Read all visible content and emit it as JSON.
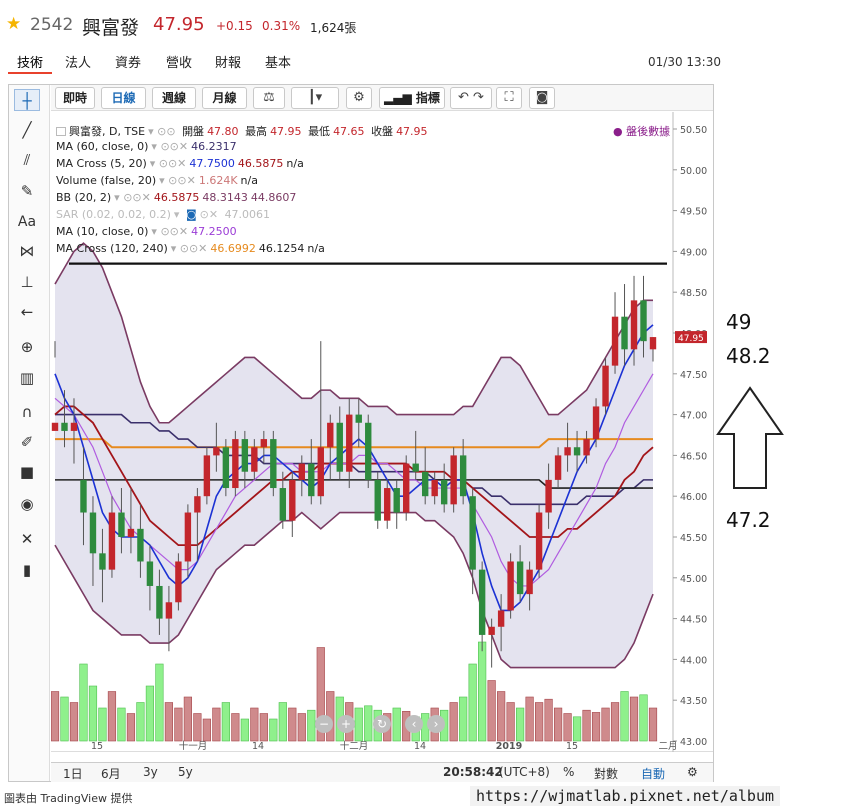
{
  "header": {
    "code": "2542",
    "name": "興富發",
    "price": "47.95",
    "change": "+0.15",
    "pct": "0.31%",
    "volume": "1,624張"
  },
  "tabs": [
    "技術",
    "法人",
    "營收",
    "營收",
    "財報",
    "基本"
  ],
  "datetime": "01/30 13:30",
  "toolbar": {
    "realtime": "即時",
    "daily": "日線",
    "weekly": "週線",
    "monthly": "月線",
    "indicators": "指標"
  },
  "legend": {
    "title": "興富發, D, TSE",
    "open_l": "開盤",
    "open": "47.80",
    "high_l": "最高",
    "high": "47.95",
    "low_l": "最低",
    "low": "47.65",
    "close_l": "收盤",
    "close": "47.95",
    "after_hours": "盤後數據",
    "ma60": {
      "label": "MA (60, close, 0)",
      "v1": "46.2317"
    },
    "macross1": {
      "label": "MA Cross (5, 20)",
      "v1": "47.7500",
      "v2": "46.5875",
      "v3": "n/a"
    },
    "volume": {
      "label": "Volume (false, 20)",
      "v1": "1.624K",
      "v2": "n/a"
    },
    "bb": {
      "label": "BB (20, 2)",
      "v1": "46.5875",
      "v2": "48.3143",
      "v3": "44.8607"
    },
    "sar": {
      "label": "SAR (0.02, 0.02, 0.2)",
      "v1": "47.0061"
    },
    "ma10": {
      "label": "MA (10, close, 0)",
      "v1": "47.2500"
    },
    "macross2": {
      "label": "MA Cross (120, 240)",
      "v1": "46.6992",
      "v2": "46.1254",
      "v3": "n/a"
    }
  },
  "axis": {
    "y_ticks": [
      "50.50",
      "50.00",
      "49.50",
      "49.00",
      "48.50",
      "48.00",
      "47.50",
      "47.00",
      "46.50",
      "46.00",
      "45.50",
      "45.00",
      "44.50",
      "44.00",
      "43.50",
      "43.00"
    ],
    "price_tag": "47.95",
    "x_ticks": [
      "15",
      "十一月",
      "14",
      "十二月",
      "14",
      "2019",
      "15",
      "二月"
    ]
  },
  "bottombar": {
    "r1d": "1日",
    "r6m": "6月",
    "r3y": "3y",
    "r5y": "5y",
    "clock": "20:58:42",
    "tz": "(UTC+8)",
    "pct": "%",
    "log": "對數",
    "auto": "自動"
  },
  "annotations": {
    "a49": "49",
    "a482": "48.2",
    "a472": "47.2"
  },
  "footer": {
    "credit": "圖表由 TradingView 提供",
    "watermark": "https://wjmatlab.pixnet.net/album"
  },
  "colors": {
    "up": "#c3262c",
    "down": "#2e8b3e",
    "ma5": "#1c32d4",
    "ma20": "#a3151a",
    "ma10": "#b05ce0",
    "ma60": "#3a2f6b",
    "ma120": "#e68a1e",
    "bb": "#7a3b63"
  },
  "chart_data": {
    "type": "candlestick",
    "dates": [
      "2018-10-01",
      "2019-01-30"
    ],
    "ylim": [
      43.0,
      50.5
    ],
    "reference_line": 48.85,
    "candles": [
      [
        46.8,
        47.9,
        47.7,
        46.9
      ],
      [
        46.9,
        47.3,
        46.6,
        46.8
      ],
      [
        46.8,
        47.2,
        46.4,
        46.9
      ],
      [
        46.2,
        46.6,
        45.4,
        45.8
      ],
      [
        45.8,
        46.0,
        44.9,
        45.3
      ],
      [
        45.3,
        45.6,
        44.7,
        45.1
      ],
      [
        45.1,
        46.0,
        45.0,
        45.8
      ],
      [
        45.8,
        46.1,
        45.3,
        45.5
      ],
      [
        45.5,
        46.1,
        45.3,
        45.6
      ],
      [
        45.6,
        45.9,
        45.0,
        45.2
      ],
      [
        45.2,
        45.4,
        44.6,
        44.9
      ],
      [
        44.9,
        45.1,
        44.3,
        44.5
      ],
      [
        44.5,
        44.9,
        44.1,
        44.7
      ],
      [
        44.7,
        45.3,
        44.6,
        45.2
      ],
      [
        45.2,
        45.9,
        45.0,
        45.8
      ],
      [
        45.8,
        46.1,
        45.2,
        46.0
      ],
      [
        46.0,
        46.6,
        45.9,
        46.5
      ],
      [
        46.5,
        46.9,
        46.3,
        46.6
      ],
      [
        46.6,
        46.7,
        46.0,
        46.1
      ],
      [
        46.1,
        46.8,
        46.0,
        46.7
      ],
      [
        46.7,
        46.8,
        46.1,
        46.3
      ],
      [
        46.3,
        46.7,
        46.2,
        46.6
      ],
      [
        46.6,
        46.8,
        46.4,
        46.7
      ],
      [
        46.7,
        46.8,
        46.0,
        46.1
      ],
      [
        46.1,
        46.3,
        45.6,
        45.7
      ],
      [
        45.7,
        46.3,
        45.5,
        46.2
      ],
      [
        46.2,
        46.5,
        46.0,
        46.4
      ],
      [
        46.4,
        46.7,
        45.9,
        46.0
      ],
      [
        46.0,
        47.9,
        45.9,
        46.6
      ],
      [
        46.6,
        47.0,
        46.2,
        46.9
      ],
      [
        46.9,
        47.1,
        46.2,
        46.3
      ],
      [
        46.3,
        47.2,
        46.1,
        47.0
      ],
      [
        47.0,
        47.2,
        46.6,
        46.9
      ],
      [
        46.9,
        47.0,
        46.1,
        46.2
      ],
      [
        46.2,
        46.3,
        45.6,
        45.7
      ],
      [
        45.7,
        46.2,
        45.6,
        46.1
      ],
      [
        46.1,
        46.2,
        45.6,
        45.8
      ],
      [
        45.8,
        46.5,
        45.7,
        46.4
      ],
      [
        46.4,
        46.8,
        46.2,
        46.3
      ],
      [
        46.3,
        46.6,
        45.9,
        46.0
      ],
      [
        46.0,
        46.3,
        45.9,
        46.2
      ],
      [
        46.2,
        46.4,
        45.8,
        45.9
      ],
      [
        45.9,
        46.6,
        45.8,
        46.5
      ],
      [
        46.5,
        46.7,
        45.9,
        46.0
      ],
      [
        46.0,
        46.1,
        44.8,
        45.1
      ],
      [
        45.1,
        45.2,
        44.1,
        44.3
      ],
      [
        44.3,
        44.5,
        43.9,
        44.4
      ],
      [
        44.4,
        44.8,
        44.1,
        44.6
      ],
      [
        44.6,
        45.3,
        44.5,
        45.2
      ],
      [
        45.2,
        45.4,
        44.7,
        44.8
      ],
      [
        44.8,
        45.2,
        44.6,
        45.1
      ],
      [
        45.1,
        45.9,
        45.0,
        45.8
      ],
      [
        45.8,
        46.4,
        45.6,
        46.2
      ],
      [
        46.2,
        46.6,
        46.1,
        46.5
      ],
      [
        46.5,
        46.9,
        46.3,
        46.6
      ],
      [
        46.6,
        46.8,
        46.3,
        46.5
      ],
      [
        46.5,
        46.8,
        46.4,
        46.7
      ],
      [
        46.7,
        47.2,
        46.6,
        47.1
      ],
      [
        47.1,
        47.7,
        47.0,
        47.6
      ],
      [
        47.6,
        48.5,
        47.5,
        48.2
      ],
      [
        48.2,
        48.6,
        47.6,
        47.8
      ],
      [
        47.8,
        48.7,
        47.6,
        48.4
      ],
      [
        48.4,
        48.7,
        47.7,
        47.9
      ],
      [
        47.8,
        47.95,
        47.65,
        47.95
      ]
    ],
    "volume": [
      0.45,
      0.4,
      0.35,
      0.7,
      0.5,
      0.3,
      0.45,
      0.3,
      0.25,
      0.35,
      0.5,
      0.7,
      0.35,
      0.3,
      0.4,
      0.25,
      0.2,
      0.3,
      0.35,
      0.25,
      0.2,
      0.3,
      0.25,
      0.2,
      0.35,
      0.3,
      0.25,
      0.28,
      0.85,
      0.45,
      0.4,
      0.35,
      0.3,
      0.32,
      0.28,
      0.25,
      0.3,
      0.27,
      0.22,
      0.25,
      0.3,
      0.28,
      0.35,
      0.4,
      0.7,
      0.9,
      0.55,
      0.45,
      0.35,
      0.3,
      0.4,
      0.35,
      0.38,
      0.3,
      0.25,
      0.22,
      0.28,
      0.26,
      0.3,
      0.35,
      0.45,
      0.4,
      0.42,
      0.3
    ],
    "ma5": [
      47.5,
      47.2,
      47.0,
      46.6,
      46.2,
      45.8,
      45.6,
      45.5,
      45.5,
      45.5,
      45.4,
      45.2,
      45.0,
      44.9,
      45.0,
      45.2,
      45.6,
      46.0,
      46.2,
      46.3,
      46.4,
      46.4,
      46.5,
      46.5,
      46.4,
      46.3,
      46.2,
      46.1,
      46.2,
      46.4,
      46.5,
      46.6,
      46.7,
      46.6,
      46.4,
      46.2,
      46.0,
      46.0,
      46.1,
      46.2,
      46.2,
      46.1,
      46.2,
      46.2,
      45.8,
      45.3,
      44.9,
      44.6,
      44.6,
      44.7,
      44.9,
      45.1,
      45.4,
      45.7,
      46.0,
      46.3,
      46.5,
      46.7,
      47.0,
      47.3,
      47.6,
      47.8,
      48.0,
      48.1
    ],
    "ma10": [
      47.2,
      47.1,
      47.0,
      46.8,
      46.6,
      46.3,
      46.0,
      45.8,
      45.6,
      45.5,
      45.4,
      45.3,
      45.2,
      45.1,
      45.1,
      45.2,
      45.4,
      45.6,
      45.8,
      46.0,
      46.1,
      46.2,
      46.3,
      46.4,
      46.4,
      46.4,
      46.3,
      46.3,
      46.3,
      46.4,
      46.4,
      46.4,
      46.5,
      46.5,
      46.4,
      46.4,
      46.3,
      46.2,
      46.2,
      46.1,
      46.1,
      46.1,
      46.1,
      46.1,
      45.9,
      45.7,
      45.5,
      45.2,
      45.0,
      44.9,
      44.9,
      45.0,
      45.1,
      45.3,
      45.5,
      45.7,
      45.9,
      46.1,
      46.4,
      46.6,
      46.9,
      47.1,
      47.3,
      47.5
    ],
    "ma20": [
      47.0,
      47.1,
      47.1,
      47.0,
      46.9,
      46.7,
      46.5,
      46.3,
      46.1,
      45.9,
      45.7,
      45.6,
      45.5,
      45.4,
      45.4,
      45.4,
      45.5,
      45.6,
      45.7,
      45.8,
      45.9,
      46.0,
      46.1,
      46.2,
      46.2,
      46.3,
      46.3,
      46.3,
      46.4,
      46.4,
      46.4,
      46.4,
      46.4,
      46.4,
      46.4,
      46.4,
      46.4,
      46.4,
      46.3,
      46.3,
      46.3,
      46.3,
      46.2,
      46.2,
      46.1,
      46.0,
      45.9,
      45.8,
      45.7,
      45.6,
      45.5,
      45.5,
      45.5,
      45.5,
      45.6,
      45.6,
      45.7,
      45.8,
      45.9,
      46.0,
      46.2,
      46.3,
      46.5,
      46.6
    ],
    "ma60": [
      47.0,
      47.0,
      47.0,
      47.0,
      47.0,
      47.0,
      47.0,
      47.0,
      46.9,
      46.9,
      46.9,
      46.8,
      46.8,
      46.7,
      46.7,
      46.6,
      46.6,
      46.6,
      46.5,
      46.5,
      46.5,
      46.5,
      46.4,
      46.4,
      46.4,
      46.4,
      46.4,
      46.4,
      46.4,
      46.4,
      46.4,
      46.4,
      46.3,
      46.3,
      46.3,
      46.3,
      46.3,
      46.3,
      46.3,
      46.3,
      46.2,
      46.2,
      46.2,
      46.2,
      46.1,
      46.1,
      46.0,
      46.0,
      45.9,
      45.9,
      45.9,
      45.9,
      45.9,
      45.9,
      45.9,
      45.9,
      46.0,
      46.0,
      46.0,
      46.0,
      46.1,
      46.1,
      46.2,
      46.2
    ],
    "ma120": [
      46.7,
      46.7,
      46.7,
      46.7,
      46.7,
      46.7,
      46.6,
      46.6,
      46.6,
      46.6,
      46.6,
      46.6,
      46.6,
      46.6,
      46.6,
      46.6,
      46.6,
      46.6,
      46.6,
      46.6,
      46.6,
      46.6,
      46.6,
      46.6,
      46.6,
      46.6,
      46.6,
      46.6,
      46.6,
      46.6,
      46.6,
      46.6,
      46.6,
      46.6,
      46.6,
      46.6,
      46.6,
      46.6,
      46.6,
      46.6,
      46.6,
      46.6,
      46.6,
      46.6,
      46.6,
      46.6,
      46.6,
      46.6,
      46.6,
      46.6,
      46.6,
      46.6,
      46.7,
      46.7,
      46.7,
      46.7,
      46.7,
      46.7,
      46.7,
      46.7,
      46.7,
      46.7,
      46.7,
      46.7
    ],
    "ma240": [
      46.2,
      46.2,
      46.2,
      46.2,
      46.2,
      46.2,
      46.2,
      46.2,
      46.2,
      46.2,
      46.2,
      46.2,
      46.2,
      46.2,
      46.2,
      46.2,
      46.2,
      46.2,
      46.2,
      46.2,
      46.2,
      46.2,
      46.2,
      46.2,
      46.2,
      46.2,
      46.2,
      46.2,
      46.2,
      46.2,
      46.2,
      46.2,
      46.2,
      46.2,
      46.2,
      46.2,
      46.2,
      46.2,
      46.2,
      46.2,
      46.2,
      46.2,
      46.2,
      46.2,
      46.2,
      46.2,
      46.2,
      46.2,
      46.2,
      46.2,
      46.2,
      46.2,
      46.1,
      46.1,
      46.1,
      46.1,
      46.1,
      46.1,
      46.1,
      46.1,
      46.1,
      46.1,
      46.1,
      46.1
    ],
    "bb_upper": [
      48.6,
      48.8,
      49.0,
      49.1,
      49.0,
      48.8,
      48.5,
      48.2,
      47.8,
      47.4,
      47.1,
      46.9,
      46.9,
      47.0,
      47.1,
      47.2,
      47.3,
      47.4,
      47.5,
      47.6,
      47.7,
      47.7,
      47.6,
      47.5,
      47.4,
      47.3,
      47.2,
      47.2,
      47.3,
      47.3,
      47.2,
      47.2,
      47.2,
      47.1,
      47.1,
      47.1,
      47.0,
      47.0,
      47.0,
      47.0,
      47.0,
      47.0,
      47.0,
      47.1,
      47.1,
      47.3,
      47.5,
      47.7,
      47.7,
      47.6,
      47.4,
      47.2,
      47.0,
      47.0,
      47.1,
      47.2,
      47.3,
      47.5,
      47.7,
      47.9,
      48.1,
      48.3,
      48.4,
      48.4
    ],
    "bb_lower": [
      45.4,
      45.2,
      45.0,
      44.8,
      44.6,
      44.5,
      44.4,
      44.3,
      44.3,
      44.3,
      44.2,
      44.2,
      44.2,
      44.3,
      44.5,
      44.7,
      44.9,
      45.1,
      45.2,
      45.3,
      45.4,
      45.4,
      45.5,
      45.6,
      45.7,
      45.7,
      45.8,
      45.7,
      45.6,
      45.7,
      45.8,
      45.8,
      45.8,
      45.8,
      45.8,
      45.8,
      45.8,
      45.8,
      45.8,
      45.7,
      45.7,
      45.6,
      45.5,
      45.3,
      45.0,
      44.6,
      44.3,
      44.0,
      43.9,
      43.9,
      43.9,
      43.9,
      43.9,
      43.9,
      43.9,
      43.9,
      43.9,
      43.9,
      43.9,
      43.9,
      44.0,
      44.2,
      44.5,
      44.8
    ]
  }
}
